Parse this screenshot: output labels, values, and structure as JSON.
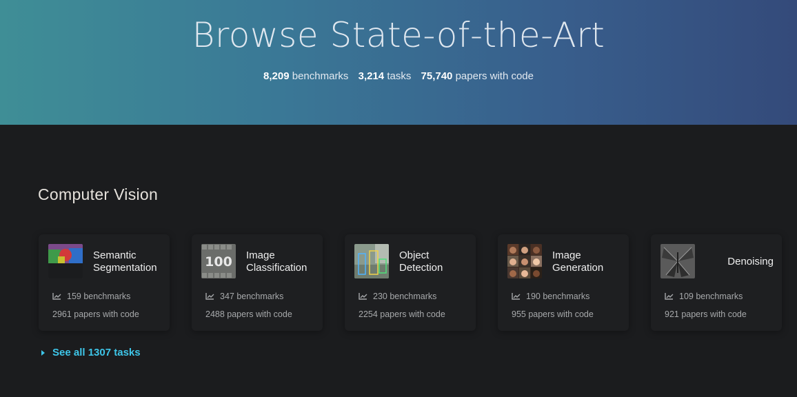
{
  "hero": {
    "title": "Browse State-of-the-Art",
    "stats": [
      {
        "num": "8,209",
        "label": "benchmarks"
      },
      {
        "num": "3,214",
        "label": "tasks"
      },
      {
        "num": "75,740",
        "label": "papers with code"
      }
    ]
  },
  "section": {
    "title": "Computer Vision",
    "cards": [
      {
        "name": "Semantic Segmentation",
        "benchmarks": "159 benchmarks",
        "papers": "2961 papers with code",
        "icon": "chart-line-icon"
      },
      {
        "name": "Image Classification",
        "benchmarks": "347 benchmarks",
        "papers": "2488 papers with code",
        "icon": "chart-line-icon"
      },
      {
        "name": "Object Detection",
        "benchmarks": "230 benchmarks",
        "papers": "2254 papers with code",
        "icon": "chart-line-icon"
      },
      {
        "name": "Image Generation",
        "benchmarks": "190 benchmarks",
        "papers": "955 papers with code",
        "icon": "chart-line-icon"
      },
      {
        "name": "Denoising",
        "benchmarks": "109 benchmarks",
        "papers": "921 papers with code",
        "icon": "chart-line-icon"
      }
    ],
    "see_all": "See all 1307 tasks"
  }
}
